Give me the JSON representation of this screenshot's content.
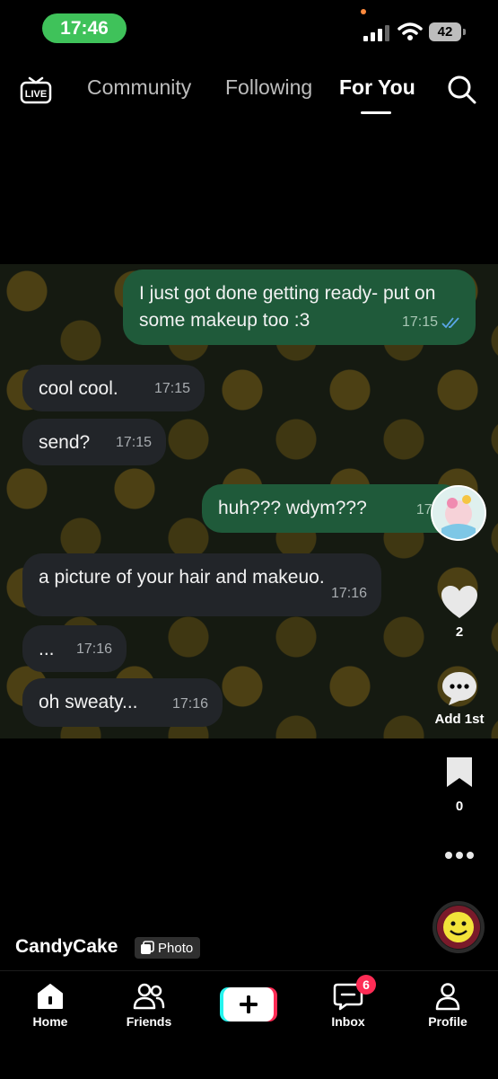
{
  "status_bar": {
    "time": "17:46",
    "battery": "42"
  },
  "top_nav": {
    "live_label": "LIVE",
    "tabs": [
      "Community",
      "Following",
      "For You"
    ],
    "active_tab": "For You"
  },
  "chat": {
    "messages": [
      {
        "side": "out",
        "text": "I just got done getting ready- put on some makeup too :3",
        "time": "17:15"
      },
      {
        "side": "in",
        "text": "cool cool.",
        "time": "17:15"
      },
      {
        "side": "in",
        "text": "send?",
        "time": "17:15"
      },
      {
        "side": "out",
        "text": "huh??? wdym???",
        "time": "17:1"
      },
      {
        "side": "in",
        "text": "a picture of your hair and makeuo.",
        "time": "17:16"
      },
      {
        "side": "in",
        "text": "...",
        "time": "17:16"
      },
      {
        "side": "in",
        "text": "oh sweaty...",
        "time": "17:16"
      }
    ]
  },
  "side_actions": {
    "like_count": "2",
    "comment_label": "Add 1st",
    "save_count": "0"
  },
  "post": {
    "username": "CandyCake",
    "type_badge": "Photo"
  },
  "bottom_nav": {
    "items": [
      "Home",
      "Friends",
      "",
      "Inbox",
      "Profile"
    ],
    "inbox_badge": "6"
  },
  "colors": {
    "accent_green": "#3fc25a",
    "bubble_out": "#1f5a3a",
    "bubble_in": "#222529",
    "badge_red": "#fe2c55"
  }
}
